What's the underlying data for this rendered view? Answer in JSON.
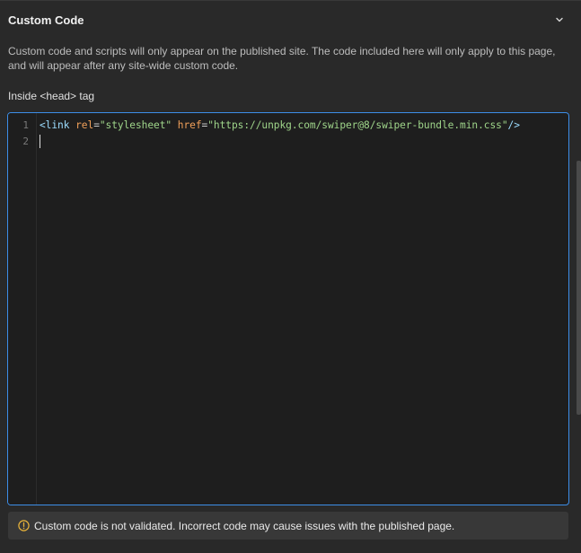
{
  "section": {
    "title": "Custom Code",
    "toggle_icon": "chevron-down-icon"
  },
  "description": "Custom code and scripts will only appear on the published site. The code included here will only apply to this page, and will appear after any site-wide custom code.",
  "head_field": {
    "label": "Inside <head> tag",
    "line_numbers": [
      "1",
      "2"
    ],
    "tokens": {
      "open": "<link",
      "attr1": "rel",
      "eq1": "=",
      "val1": "\"stylesheet\"",
      "attr2": "href",
      "eq2": "=",
      "val2": "\"https://unpkg.com/swiper@8/swiper-bundle.min.css\"",
      "close": "/>"
    }
  },
  "warning": {
    "icon": "warning-circle-icon",
    "text": "Custom code is not validated. Incorrect code may cause issues with the published page."
  },
  "colors": {
    "accent": "#3d8ee8",
    "tag": "#9cdcfe",
    "attribute": "#f2a15a",
    "string": "#9fd58a",
    "warning_icon": "#e8b33a"
  }
}
